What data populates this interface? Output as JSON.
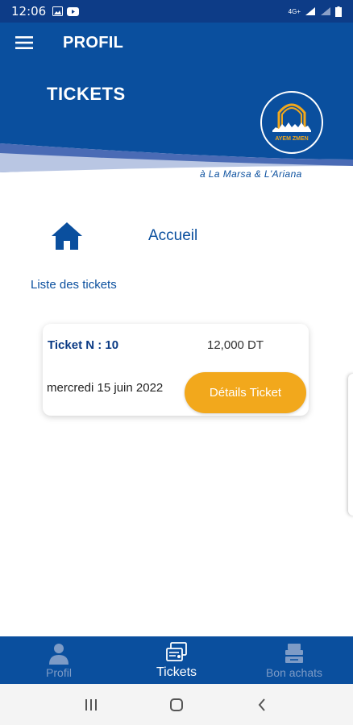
{
  "status": {
    "time": "12:06",
    "network": "4G+"
  },
  "app_bar": {
    "title": "PROFIL",
    "menu_icon": "hamburger-menu-icon"
  },
  "hero": {
    "title": "TICKETS",
    "logo_text": "AYEM ZMEN",
    "tagline": "à La Marsa & L'Ariana"
  },
  "home": {
    "label": "Accueil",
    "icon": "home-icon"
  },
  "list": {
    "title": "Liste des tickets"
  },
  "tickets": [
    {
      "number_label": "Ticket N : 10",
      "amount": "12,000 DT",
      "date": "mercredi 15 juin 2022",
      "button_label": "Détails Ticket"
    }
  ],
  "bottom_nav": {
    "items": [
      {
        "label": "Profil",
        "icon": "person-icon",
        "active": false
      },
      {
        "label": "Tickets",
        "icon": "tickets-icon",
        "active": true
      },
      {
        "label": "Bon achats",
        "icon": "voucher-icon",
        "active": false
      }
    ]
  },
  "colors": {
    "primary": "#0a4f9e",
    "status_bar": "#0d3c87",
    "accent": "#f2a81c",
    "inactive_nav": "#7d9bc6"
  }
}
